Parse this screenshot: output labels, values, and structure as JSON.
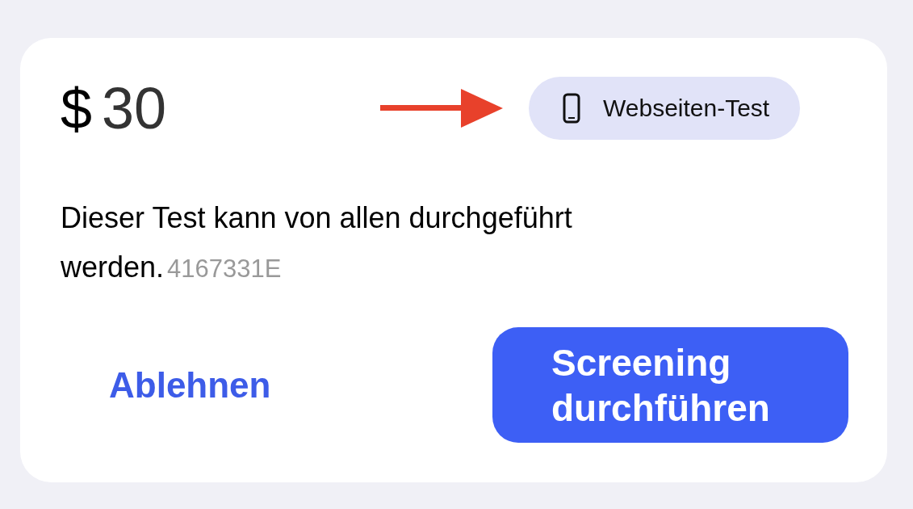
{
  "price": {
    "currency": "$",
    "amount": "30"
  },
  "badge": {
    "label": "Webseiten-Test"
  },
  "description": {
    "lines": [
      "Dieser Test kann von allen durchgeführt",
      "werden."
    ],
    "code": "4167331E"
  },
  "buttons": [
    {
      "label": "Ablehnen",
      "kind": "text"
    },
    {
      "label": "Screening durchführen",
      "kind": "primary"
    }
  ]
}
